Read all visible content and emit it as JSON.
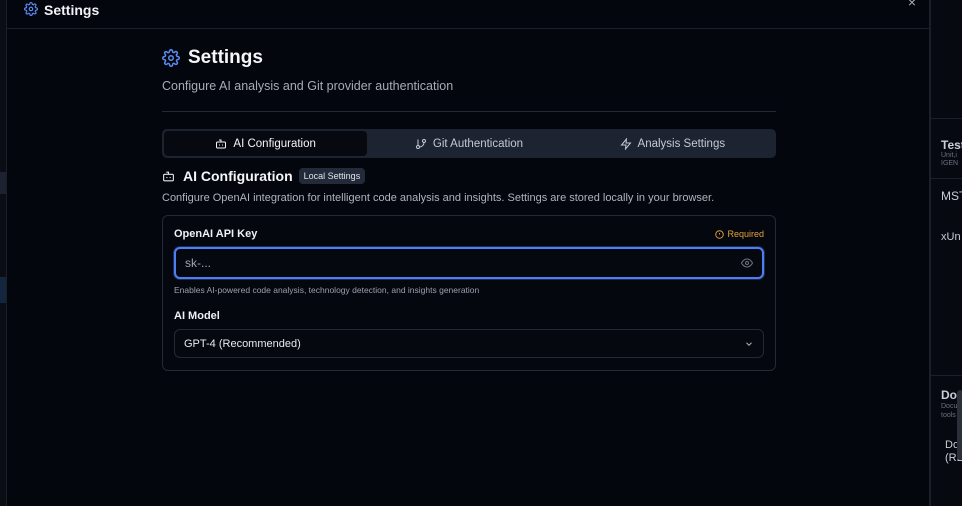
{
  "modal": {
    "header_title": "Settings",
    "close_symbol": "×"
  },
  "page": {
    "title": "Settings",
    "subtitle": "Configure AI analysis and Git provider authentication"
  },
  "tabs": [
    {
      "label": "AI Configuration",
      "icon": "bot-icon",
      "active": true
    },
    {
      "label": "Git Authentication",
      "icon": "git-branch-icon",
      "active": false
    },
    {
      "label": "Analysis Settings",
      "icon": "zap-icon",
      "active": false
    }
  ],
  "section": {
    "title": "AI Configuration",
    "badge": "Local Settings",
    "description": "Configure OpenAI integration for intelligent code analysis and insights. Settings are stored locally in your browser."
  },
  "api_key": {
    "label": "OpenAI API Key",
    "required_text": "Required",
    "placeholder": "sk-...",
    "hint": "Enables AI-powered code analysis, technology detection, and insights generation"
  },
  "model": {
    "label": "AI Model",
    "selected": "GPT-4 (Recommended)"
  },
  "background_right": {
    "frag1": "Test",
    "frag1_sub": "Unit,i",
    "frag1_sub2": "IGEN",
    "frag2": "MSTe",
    "frag3": "xUn",
    "frag4": "Doc",
    "frag4_sub": "Docu",
    "frag4_sub2": "tools",
    "frag5": "Doc",
    "frag5_b": "(REA"
  },
  "colors": {
    "accent": "#4d7ef2",
    "warning": "#e2a23a",
    "background": "#03060c"
  }
}
